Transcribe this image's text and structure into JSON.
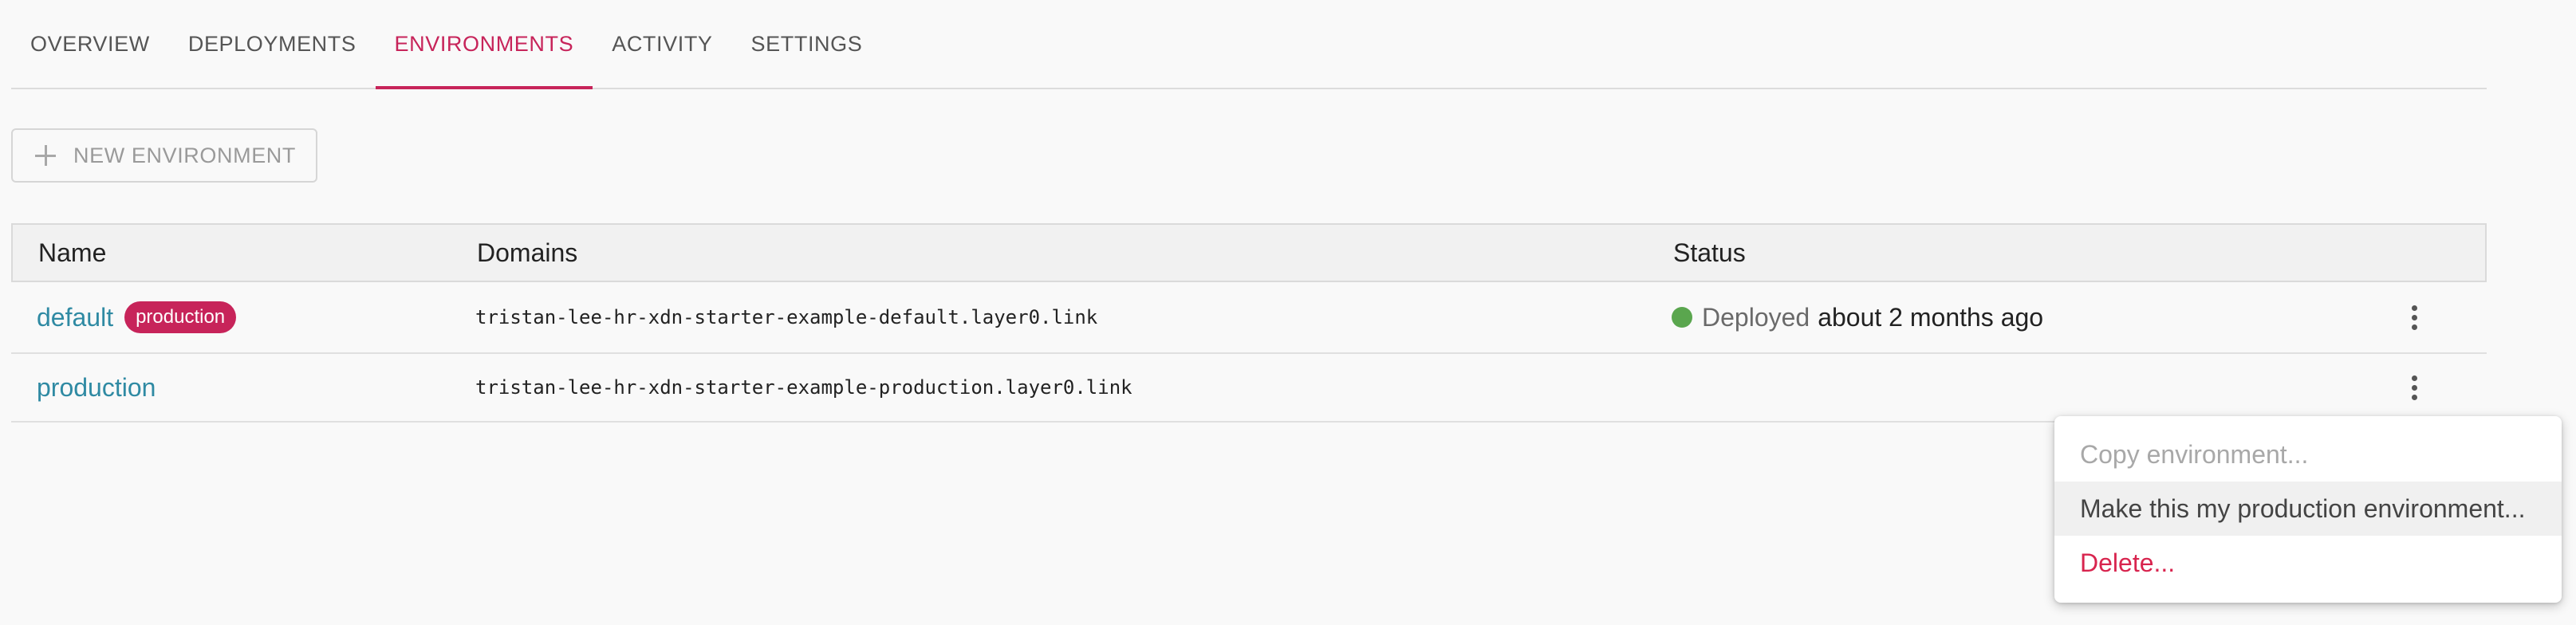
{
  "tabs": [
    {
      "label": "OVERVIEW"
    },
    {
      "label": "DEPLOYMENTS"
    },
    {
      "label": "ENVIRONMENTS",
      "active": true
    },
    {
      "label": "ACTIVITY"
    },
    {
      "label": "SETTINGS"
    }
  ],
  "new_env_button": {
    "label": "NEW ENVIRONMENT",
    "icon": "plus-icon"
  },
  "table": {
    "headers": {
      "name": "Name",
      "domains": "Domains",
      "status": "Status"
    },
    "rows": [
      {
        "name": "default",
        "badge": "production",
        "domain": "tristan-lee-hr-xdn-starter-example-default.layer0.link",
        "status_label": "Deployed",
        "status_time": "about 2 months ago",
        "status_color": "#5aa64e"
      },
      {
        "name": "production",
        "domain": "tristan-lee-hr-xdn-starter-example-production.layer0.link"
      }
    ]
  },
  "context_menu": {
    "items": [
      {
        "label": "Copy environment...",
        "state": "disabled"
      },
      {
        "label": "Make this my production environment...",
        "state": "hover"
      },
      {
        "label": "Delete...",
        "state": "danger"
      }
    ]
  },
  "colors": {
    "accent": "#c7245a",
    "link": "#2f8aa3",
    "danger": "#d8244e",
    "success": "#5aa64e"
  }
}
